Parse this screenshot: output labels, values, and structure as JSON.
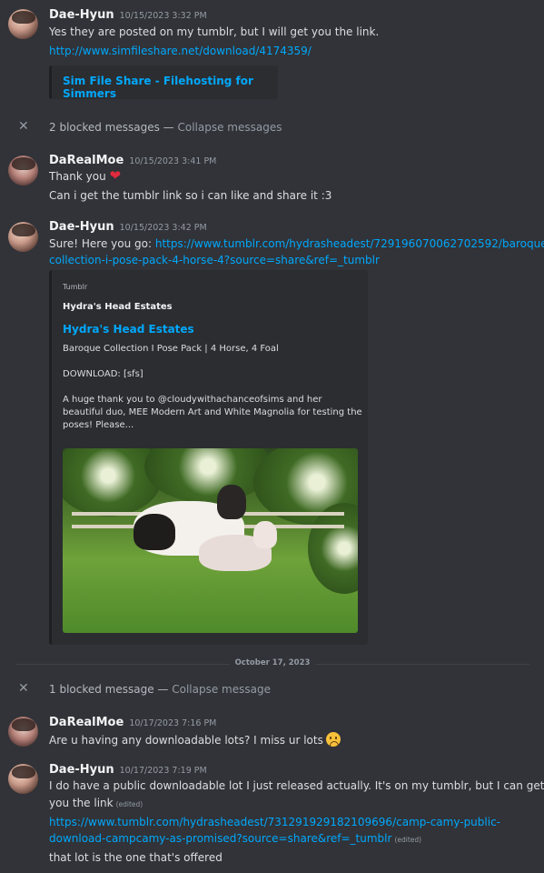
{
  "messages": [
    {
      "author": "Dae-Hyun",
      "timestamp": "10/15/2023 3:32 PM",
      "text": "Yes they are posted on my tumblr, but I will get you the link.",
      "link": "http://www.simfileshare.net/download/4174359/",
      "embed_title": "Sim File Share - Filehosting for Simmers"
    },
    {
      "blocked_text": "2 blocked messages",
      "collapse_text": "Collapse messages"
    },
    {
      "author": "DaRealMoe",
      "timestamp": "10/15/2023 3:41 PM",
      "line1": "Thank you",
      "line2": "Can i get the tumblr link so i can like and share it :3"
    },
    {
      "author": "Dae-Hyun",
      "timestamp": "10/15/2023 3:42 PM",
      "text_prefix": "Sure! Here you go: ",
      "link_line1": "https://www.tumblr.com/hydrasheadest/729196070062702592/baroque-",
      "link_line2": "collection-i-pose-pack-4-horse-4?source=share&ref=_tumblr",
      "embed": {
        "provider": "Tumblr",
        "author": "Hydra's Head Estates",
        "title": "Hydra's Head Estates",
        "desc1": "Baroque Collection I Pose Pack | 4 Horse, 4 Foal",
        "desc2": "DOWNLOAD: [sfs]",
        "desc3": "A huge thank you to @cloudywithachanceofsims and her beautiful duo, MEE Modern Art and White Magnolia for testing the poses! Please..."
      }
    },
    {
      "date_divider": "October 17, 2023"
    },
    {
      "blocked_text": "1 blocked message",
      "collapse_text": "Collapse message"
    },
    {
      "author": "DaRealMoe",
      "timestamp": "10/17/2023 7:16 PM",
      "text": "Are u having any downloadable lots? I miss ur lots"
    },
    {
      "author": "Dae-Hyun",
      "timestamp": "10/17/2023 7:19 PM",
      "line1": "I do have a public downloadable lot I just released actually. It's on my tumblr, but I can get",
      "line2": "you the link",
      "edited": "(edited)",
      "link_line1": "https://www.tumblr.com/hydrasheadest/731291929182109696/camp-camy-public-",
      "link_line2": "download-campcamy-as-promised?source=share&ref=_tumblr",
      "line5": "that lot is the one that's offered"
    }
  ],
  "separator": " — ",
  "colors": {
    "background": "#313338",
    "link": "#00a8fc",
    "embed_bg": "#2b2d31"
  }
}
